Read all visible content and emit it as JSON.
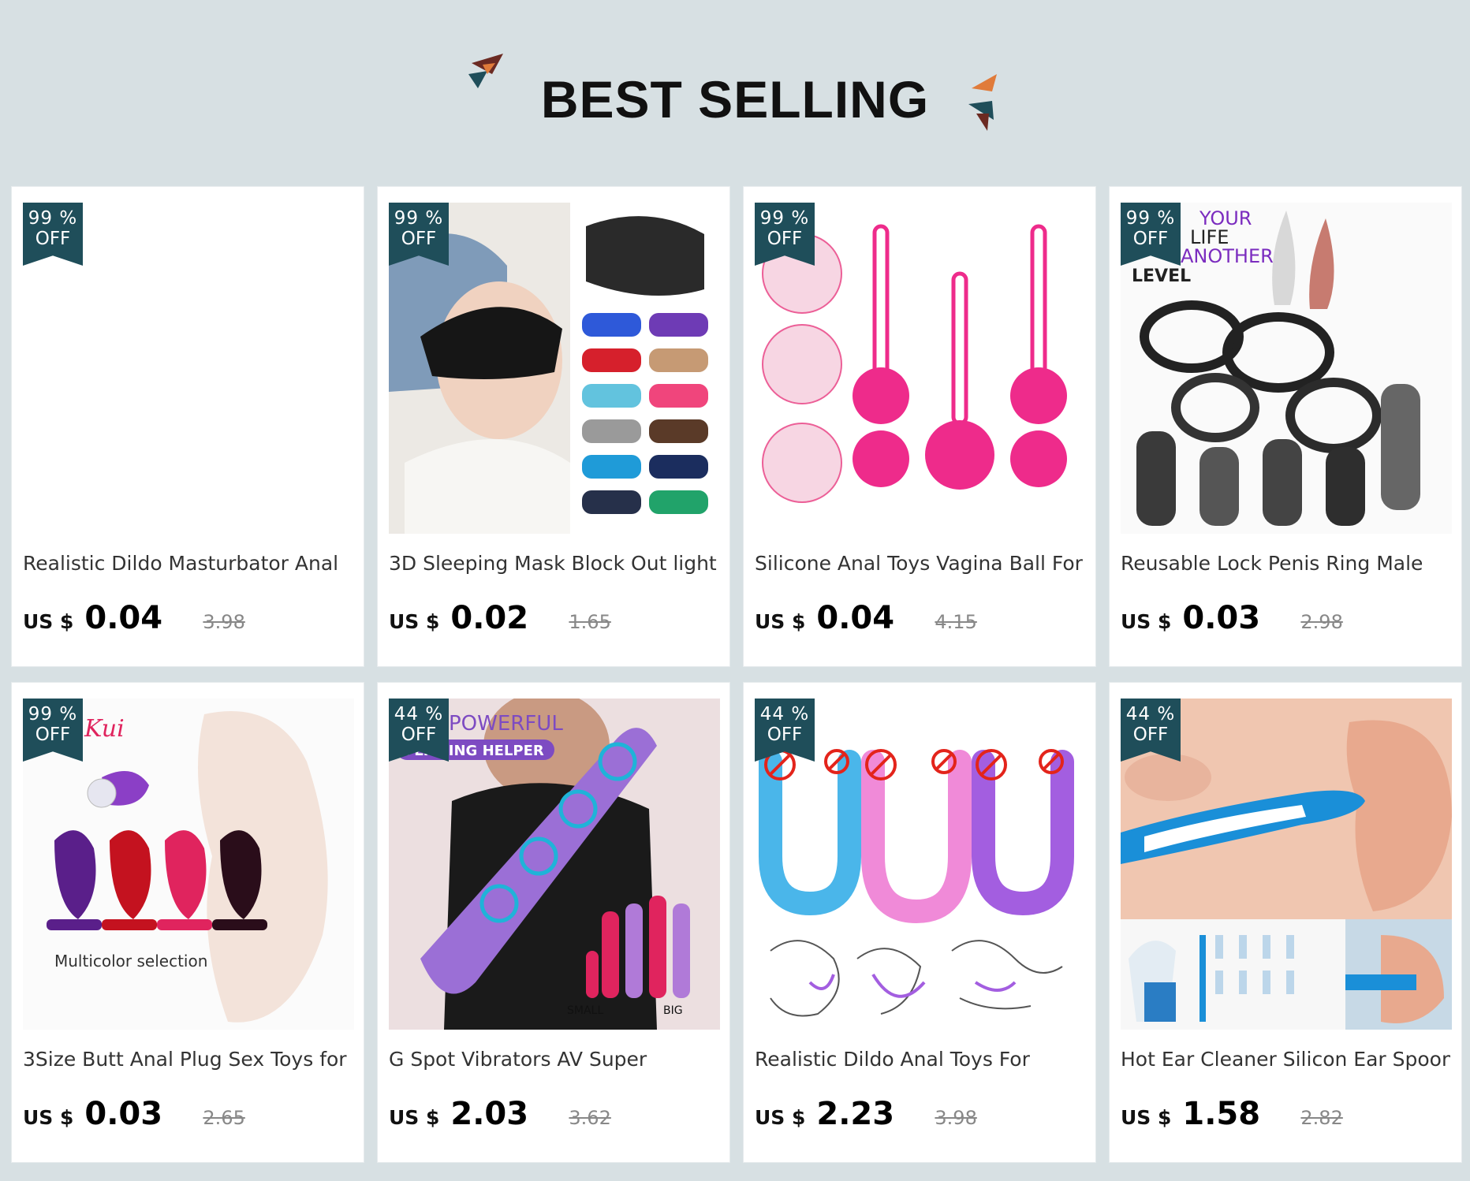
{
  "section": {
    "title": "BEST SELLING"
  },
  "colors": {
    "badge": "#1f4e5a",
    "background": "#d7e0e3"
  },
  "products": [
    {
      "discount_pct": "99 %",
      "off": "OFF",
      "name": "Realistic Dildo Masturbator Anal",
      "currency": "US $",
      "price": "0.04",
      "original_price": "3.98",
      "image_icon": "blank-product-image"
    },
    {
      "discount_pct": "99 %",
      "off": "OFF",
      "name": "3D Sleeping Mask Block Out light",
      "currency": "US $",
      "price": "0.02",
      "original_price": "1.65",
      "image_icon": "sleeping-mask-image"
    },
    {
      "discount_pct": "99 %",
      "off": "OFF",
      "name": "Silicone Anal Toys Vagina Ball For",
      "currency": "US $",
      "price": "0.04",
      "original_price": "4.15",
      "image_icon": "pink-balls-image"
    },
    {
      "discount_pct": "99 %",
      "off": "OFF",
      "name": "Reusable Lock Penis Ring Male",
      "currency": "US $",
      "price": "0.03",
      "original_price": "2.98",
      "image_icon": "rings-image",
      "image_text": [
        "YOUR",
        "LIFE",
        "ANOTHER",
        "LEVEL"
      ]
    },
    {
      "discount_pct": "99 %",
      "off": "OFF",
      "name": "3Size Butt Anal Plug Sex Toys for",
      "currency": "US $",
      "price": "0.03",
      "original_price": "2.65",
      "image_icon": "plugs-image",
      "image_text": [
        "Kui",
        "Multicolor selection"
      ]
    },
    {
      "discount_pct": "44 %",
      "off": "OFF",
      "name": "G Spot Vibrators AV Super",
      "currency": "US $",
      "price": "2.03",
      "original_price": "3.62",
      "image_icon": "vibrator-image",
      "image_text": [
        "POWERFUL",
        "FLIRTING HELPER",
        "SMALL",
        "BIG"
      ]
    },
    {
      "discount_pct": "44 %",
      "off": "OFF",
      "name": "Realistic Dildo Anal Toys For",
      "currency": "US $",
      "price": "2.23",
      "original_price": "3.98",
      "image_icon": "u-shaped-toys-image"
    },
    {
      "discount_pct": "44 %",
      "off": "OFF",
      "name": "Hot Ear Cleaner Silicon Ear Spoon",
      "currency": "US $",
      "price": "1.58",
      "original_price": "2.82",
      "image_icon": "ear-cleaner-image"
    }
  ]
}
